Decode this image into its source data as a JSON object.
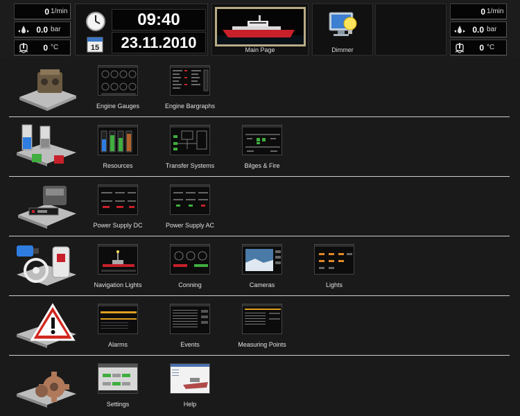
{
  "left_engine": {
    "rpm_value": "0",
    "rpm_unit": "1/min",
    "pressure_value": "0.0",
    "pressure_unit": "bar",
    "temp_value": "0",
    "temp_unit": "°C"
  },
  "right_engine": {
    "rpm_value": "0",
    "rpm_unit": "1/min",
    "pressure_value": "0.0",
    "pressure_unit": "bar",
    "temp_value": "0",
    "temp_unit": "°C"
  },
  "clock": {
    "time": "09:40",
    "date": "23.11.2010",
    "calendar_day": "15"
  },
  "tiles": {
    "main_page": "Main Page",
    "dimmer": "Dimmer"
  },
  "rows": [
    {
      "icon": "engine-icon",
      "items": [
        "Engine Gauges",
        "Engine Bargraphs"
      ]
    },
    {
      "icon": "tanks-icon",
      "items": [
        "Resources",
        "Transfer Systems",
        "Bilges & Fire"
      ]
    },
    {
      "icon": "power-icon",
      "items": [
        "Power Supply DC",
        "Power Supply AC"
      ]
    },
    {
      "icon": "navigation-icon",
      "items": [
        "Navigation Lights",
        "Conning",
        "Cameras",
        "Lights"
      ]
    },
    {
      "icon": "alarm-icon",
      "items": [
        "Alarms",
        "Events",
        "Measuring Points"
      ]
    },
    {
      "icon": "settings-icon",
      "items": [
        "Settings",
        "Help"
      ]
    }
  ],
  "colors": {
    "background": "#1a1a1a",
    "separator": "#cfcfcf",
    "frame_gold": "#b9ab86",
    "alarm_red": "#d0261e",
    "ship_red": "#c8202a"
  }
}
